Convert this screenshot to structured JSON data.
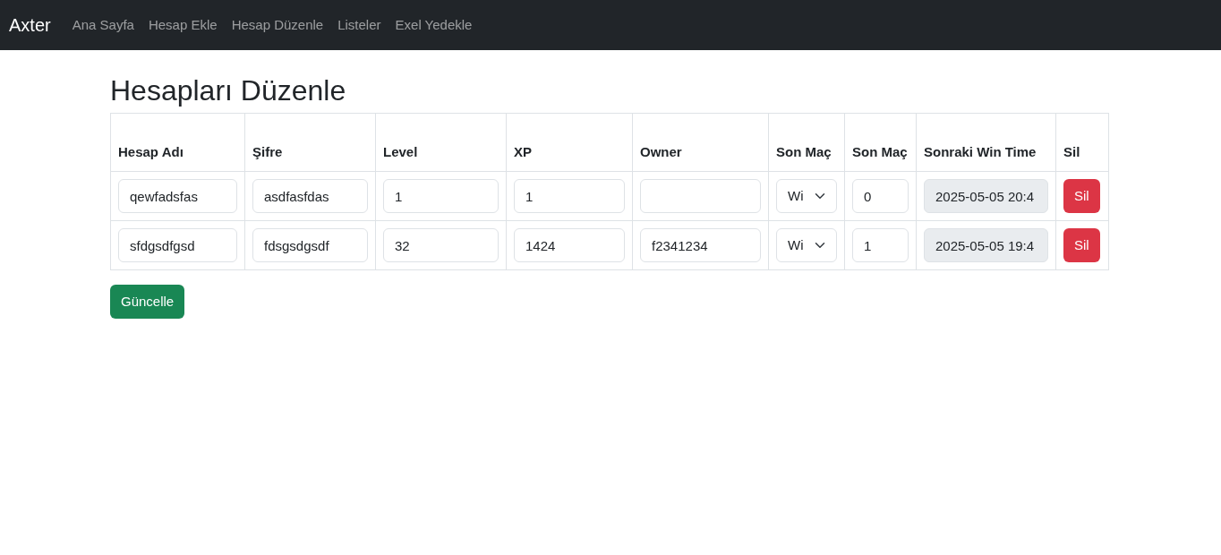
{
  "navbar": {
    "brand": "Axter",
    "links": [
      {
        "label": "Ana Sayfa"
      },
      {
        "label": "Hesap Ekle"
      },
      {
        "label": "Hesap Düzenle"
      },
      {
        "label": "Listeler"
      },
      {
        "label": "Exel Yedekle"
      }
    ]
  },
  "page": {
    "title": "Hesapları Düzenle"
  },
  "table": {
    "columns": [
      "Hesap Adı",
      "Şifre",
      "Level",
      "XP",
      "Owner",
      "Son Maç",
      "Son Maç",
      "Sonraki Win Time",
      "Sil"
    ],
    "rows": [
      {
        "cells": [
          {
            "kind": "text",
            "value": "qewfadsfas"
          },
          {
            "kind": "text",
            "value": "asdfasfdas"
          },
          {
            "kind": "text",
            "value": "1"
          },
          {
            "kind": "text",
            "value": "1"
          },
          {
            "kind": "text"
          },
          {
            "kind": "select",
            "value": "Wi"
          },
          {
            "kind": "text",
            "value": "0"
          },
          {
            "kind": "readonly",
            "value": "2025-05-05 20:4"
          },
          {
            "kind": "button",
            "value": "Sil"
          }
        ]
      },
      {
        "cells": [
          {
            "kind": "text",
            "value": "sfdgsdfgsd"
          },
          {
            "kind": "text",
            "value": "fdsgsdgsdf"
          },
          {
            "kind": "text",
            "value": "32"
          },
          {
            "kind": "text",
            "value": "1424"
          },
          {
            "kind": "text",
            "value": "f2341234"
          },
          {
            "kind": "select",
            "value": "Wi"
          },
          {
            "kind": "text",
            "value": "1"
          },
          {
            "kind": "readonly",
            "value": "2025-05-05 19:4"
          },
          {
            "kind": "button",
            "value": "Sil"
          }
        ]
      }
    ]
  },
  "submit": {
    "label": "Güncelle"
  }
}
